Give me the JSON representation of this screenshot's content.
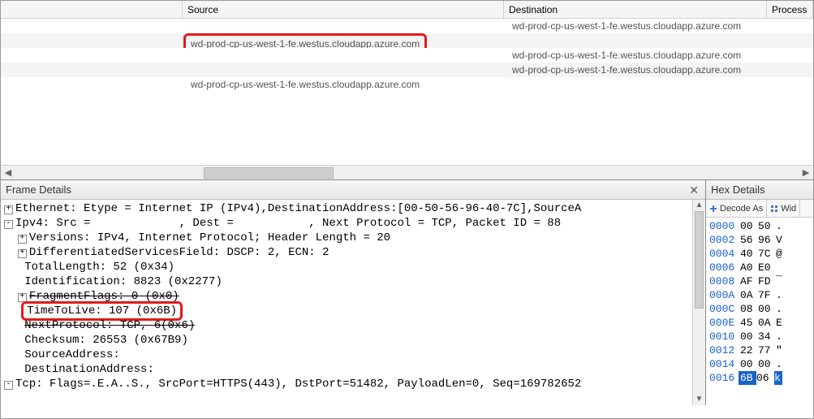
{
  "grid": {
    "headers": {
      "source": "Source",
      "destination": "Destination",
      "process": "Process"
    },
    "rows": [
      {
        "source": "",
        "dest": "wd-prod-cp-us-west-1-fe.westus.cloudapp.azure.com",
        "alt": false
      },
      {
        "source": "wd-prod-cp-us-west-1-fe.westus.cloudapp.azure.com",
        "dest": "",
        "alt": true,
        "highlightSource": true
      },
      {
        "source": "",
        "dest": "wd-prod-cp-us-west-1-fe.westus.cloudapp.azure.com",
        "alt": false
      },
      {
        "source": "",
        "dest": "wd-prod-cp-us-west-1-fe.westus.cloudapp.azure.com",
        "alt": true
      },
      {
        "source": "wd-prod-cp-us-west-1-fe.westus.cloudapp.azure.com",
        "dest": "",
        "alt": false
      }
    ]
  },
  "frameDetails": {
    "title": "Frame Details",
    "lines": [
      {
        "indent": 0,
        "glyph": "+",
        "text": "Ethernet: Etype = Internet IP (IPv4),DestinationAddress:[00-50-56-96-40-7C],SourceA"
      },
      {
        "indent": 0,
        "glyph": "-",
        "text": "Ipv4: Src =             , Dest =           , Next Protocol = TCP, Packet ID = 88"
      },
      {
        "indent": 1,
        "glyph": "+",
        "text": "Versions: IPv4, Internet Protocol; Header Length = 20"
      },
      {
        "indent": 1,
        "glyph": "+",
        "text": "DifferentiatedServicesField: DSCP: 2, ECN: 2"
      },
      {
        "indent": 1,
        "glyph": "",
        "text": "TotalLength: 52 (0x34)"
      },
      {
        "indent": 1,
        "glyph": "",
        "text": "Identification: 8823 (0x2277)"
      },
      {
        "indent": 1,
        "glyph": "+",
        "text": "FragmentFlags: 0 (0x0)",
        "strike": true
      },
      {
        "indent": 1,
        "glyph": "",
        "text": "TimeToLive: 107 (0x6B)",
        "ttl": true
      },
      {
        "indent": 1,
        "glyph": "",
        "text": "NextProtocol: TCP, 6(0x6)",
        "strike": true
      },
      {
        "indent": 1,
        "glyph": "",
        "text": "Checksum: 26553 (0x67B9)"
      },
      {
        "indent": 1,
        "glyph": "",
        "text": "SourceAddress:"
      },
      {
        "indent": 1,
        "glyph": "",
        "text": "DestinationAddress:"
      },
      {
        "indent": 0,
        "glyph": "-",
        "text": "Tcp: Flags=.E.A..S., SrcPort=HTTPS(443), DstPort=51482, PayloadLen=0, Seq=169782652"
      }
    ]
  },
  "hexDetails": {
    "title": "Hex Details",
    "toolbar": {
      "decode": "Decode As",
      "width": "Wid"
    },
    "rows": [
      {
        "off": "0000",
        "b1": "00",
        "b2": "50",
        "a": "."
      },
      {
        "off": "0002",
        "b1": "56",
        "b2": "96",
        "a": "V"
      },
      {
        "off": "0004",
        "b1": "40",
        "b2": "7C",
        "a": "@"
      },
      {
        "off": "0006",
        "b1": "A0",
        "b2": "E0",
        "a": " "
      },
      {
        "off": "0008",
        "b1": "AF",
        "b2": "FD",
        "a": "¯"
      },
      {
        "off": "000A",
        "b1": "0A",
        "b2": "7F",
        "a": "."
      },
      {
        "off": "000C",
        "b1": "08",
        "b2": "00",
        "a": "."
      },
      {
        "off": "000E",
        "b1": "45",
        "b2": "0A",
        "a": "E"
      },
      {
        "off": "0010",
        "b1": "00",
        "b2": "34",
        "a": "."
      },
      {
        "off": "0012",
        "b1": "22",
        "b2": "77",
        "a": "\""
      },
      {
        "off": "0014",
        "b1": "00",
        "b2": "00",
        "a": "."
      },
      {
        "off": "0016",
        "b1": "6B",
        "b2": "06",
        "a": "k",
        "sel": true
      }
    ]
  }
}
